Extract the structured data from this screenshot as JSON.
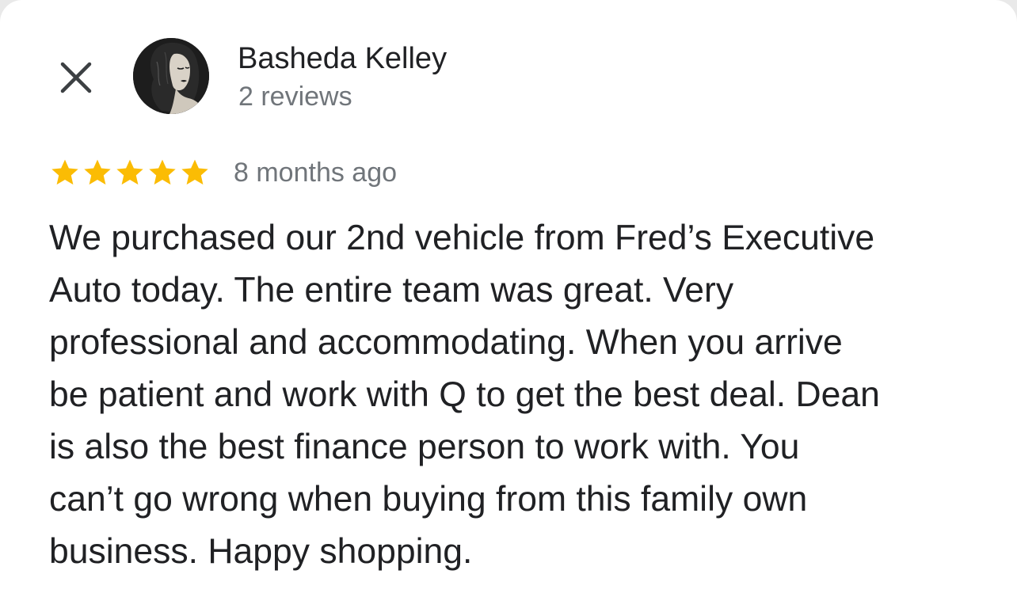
{
  "header": {
    "close_icon": "close-icon",
    "avatar_icon": "avatar-portrait-icon"
  },
  "reviewer": {
    "name": "Basheda Kelley",
    "review_count": "2 reviews"
  },
  "review": {
    "rating": 5,
    "rating_max": 5,
    "star_color": "#fbbc04",
    "time": "8 months ago",
    "text": "We purchased our 2nd vehicle from Fred’s Executive\nAuto today. The entire team was great. Very\nprofessional and accommodating. When you arrive\nbe patient and work with Q to get the best deal. Dean\nis also the best finance person to work with.  You\ncan’t go wrong when buying from this family own\nbusiness.  Happy shopping."
  }
}
